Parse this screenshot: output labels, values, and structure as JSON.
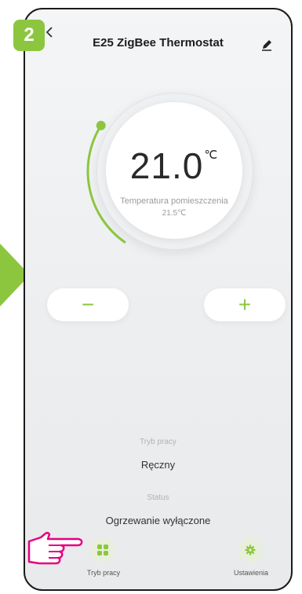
{
  "step_number": "2",
  "header": {
    "title": "E25 ZigBee Thermostat"
  },
  "dial": {
    "set_temperature": "21.0",
    "unit": "℃",
    "room_label": "Temperatura pomieszczenia",
    "room_value": "21.5℃",
    "level_fraction": 0.3
  },
  "controls": {
    "minus_label": "−",
    "plus_label": "+"
  },
  "mode": {
    "label": "Tryb pracy",
    "value": "Ręczny"
  },
  "status": {
    "label": "Status",
    "value": "Ogrzewanie wyłączone"
  },
  "nav": {
    "mode_label": "Tryb pracy",
    "settings_label": "Ustawienia"
  },
  "colors": {
    "accent": "#8cc63f",
    "hand": "#e6007e"
  },
  "icons": {
    "back": "back-arrow-icon",
    "edit": "pencil-icon",
    "mode": "grid-icon",
    "settings": "gear-icon",
    "pointer": "pointing-hand-icon",
    "indicator": "arrow-right-icon"
  }
}
